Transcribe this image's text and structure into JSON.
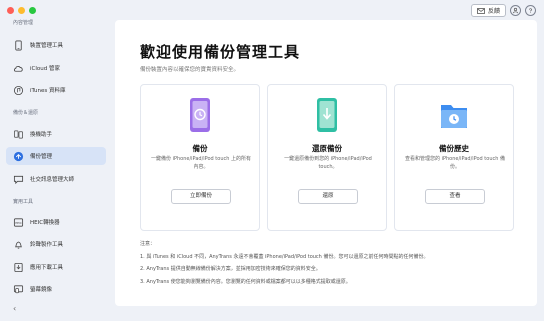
{
  "header": {
    "feedback_label": "反饋"
  },
  "sidebar": {
    "sections": [
      {
        "title": "內容管理"
      },
      {
        "title": "備份＆還原"
      },
      {
        "title": "實用工具"
      }
    ],
    "items": [
      {
        "label": "裝置管理工具"
      },
      {
        "label": "iCloud 管家"
      },
      {
        "label": "iTunes 資料庫"
      },
      {
        "label": "換機助手"
      },
      {
        "label": "備份管理"
      },
      {
        "label": "社交訊息管理大師"
      },
      {
        "label": "HEIC轉換器"
      },
      {
        "label": "鈴聲製作工具"
      },
      {
        "label": "應用下載工具"
      },
      {
        "label": "螢幕鏡像"
      }
    ],
    "collapse_glyph": "‹"
  },
  "main": {
    "title": "歡迎使用備份管理工具",
    "subtitle": "備份裝置內容以確保您的寶貴資料安全。",
    "cards": [
      {
        "title": "備份",
        "desc": "一鍵備份 iPhone/iPad/iPod touch 上的所有內容。",
        "button": "立即備份",
        "color": "#9b6ee8"
      },
      {
        "title": "還原備份",
        "desc": "一鍵還原備份到您的 iPhone/iPad/iPod touch。",
        "button": "還原",
        "color": "#2fbfa4"
      },
      {
        "title": "備份歷史",
        "desc": "查看和管理您的 iPhone/iPad/iPod touch 備份。",
        "button": "查看",
        "color": "#3d8df0"
      }
    ],
    "notes": {
      "heading": "注意：",
      "lines": [
        "1. 與 iTunes 和 iCloud 不同，AnyTrans 永遠不會覆蓋 iPhone/iPad/iPod touch 備份。您可以還原之前任何時間點的任何備份。",
        "2. AnyTrans 提供自動無線備份解決方案，並採用加密技術來確保您的資料安全。",
        "3. AnyTrans 使您能夠瀏覽備份內容。您瀏覽的任何資料或檔案都可以以多種格式提取或還原。"
      ]
    }
  }
}
